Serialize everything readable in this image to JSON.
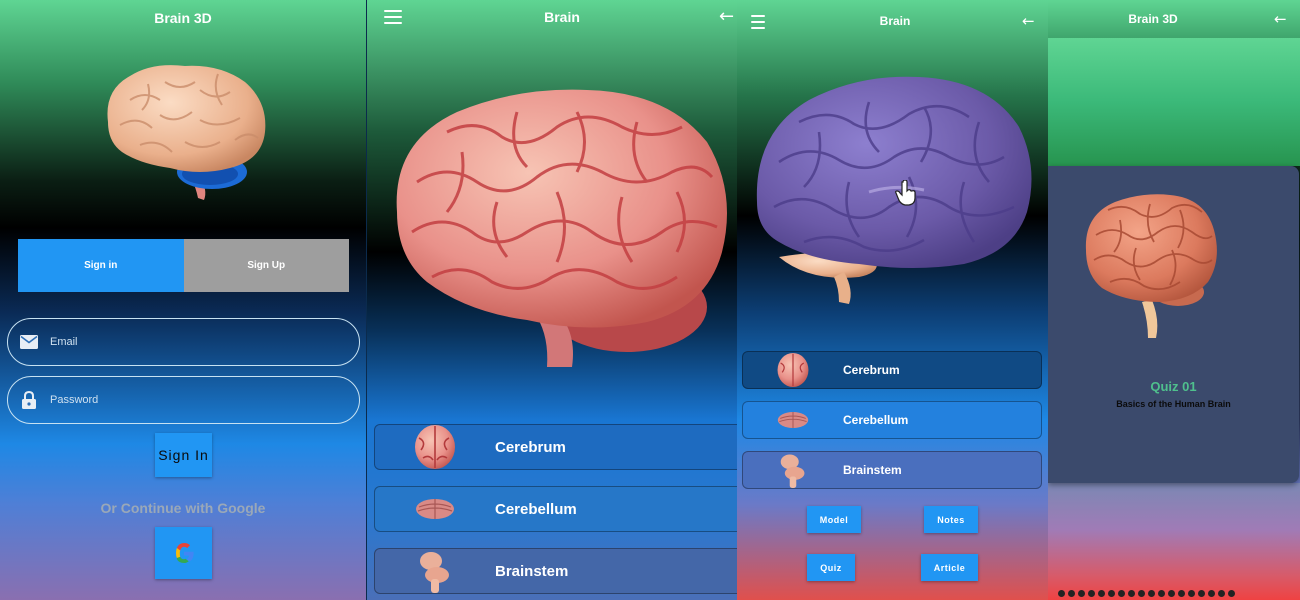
{
  "login_screen": {
    "title": "Brain 3D",
    "tabs": {
      "sign_in": "Sign in",
      "sign_up": "Sign Up"
    },
    "email_placeholder": "Email",
    "password_placeholder": "Password",
    "sign_in_button": "Sign In",
    "google_text": "Or Continue with Google",
    "icons": [
      "brain-model-image",
      "mail-icon",
      "lock-icon",
      "google-icon"
    ]
  },
  "brain_screen": {
    "title": "Brain",
    "parts": [
      "Cerebrum",
      "Cerebellum",
      "Brainstem"
    ],
    "icons": [
      "menu-icon",
      "back-arrow-icon"
    ]
  },
  "brain_detail_screen": {
    "title": "Brain",
    "parts": [
      "Cerebrum",
      "Cerebellum",
      "Brainstem"
    ],
    "actions": {
      "model": "Model",
      "notes": "Notes",
      "quiz": "Quiz",
      "article": "Article"
    },
    "highlight_color": "#6b5aa8",
    "icons": [
      "menu-icon",
      "back-arrow-icon",
      "hand-pointer-icon"
    ]
  },
  "quiz_screen": {
    "title": "Brain 3D",
    "quiz_title": "Quiz 01",
    "quiz_subtitle": "Basics of the Human Brain",
    "page_dots": 18,
    "icons": [
      "back-arrow-icon"
    ]
  },
  "colors": {
    "primary": "#2196f3",
    "green_accent": "#5fd593",
    "quiz_title": "#4fc08d",
    "tab_inactive": "#9e9e9e"
  }
}
